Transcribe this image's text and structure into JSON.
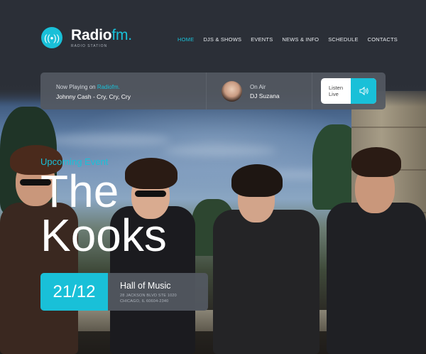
{
  "brand": {
    "name": "Radio",
    "name_accent": "fm.",
    "tagline": "RADIO STATION",
    "accent_color": "#19c0d8",
    "icon": "radio-waves-icon"
  },
  "nav": {
    "items": [
      {
        "label": "HOME",
        "active": true
      },
      {
        "label": "DJS & SHOWS",
        "active": false
      },
      {
        "label": "EVENTS",
        "active": false
      },
      {
        "label": "NEWS & INFO",
        "active": false
      },
      {
        "label": "SCHEDULE",
        "active": false
      },
      {
        "label": "CONTACTS",
        "active": false
      }
    ]
  },
  "player": {
    "now_playing_label": "Now Playing on",
    "now_playing_brand": "Radiofm.",
    "track": "Johnny Cash - Cry, Cry, Cry",
    "on_air_label": "On Air",
    "dj_name": "DJ Suzana",
    "listen_label_1": "Listen",
    "listen_label_2": "Live",
    "listen_icon": "speaker-icon"
  },
  "event": {
    "kicker": "Upcoming Event",
    "title_line_1": "The",
    "title_line_2": "Kooks",
    "date": "21/12",
    "venue": "Hall of Music",
    "address_line_1": "28 JACKSON BLVD STE 1020",
    "address_line_2": "CHICAGO, IL 60604-2340"
  }
}
